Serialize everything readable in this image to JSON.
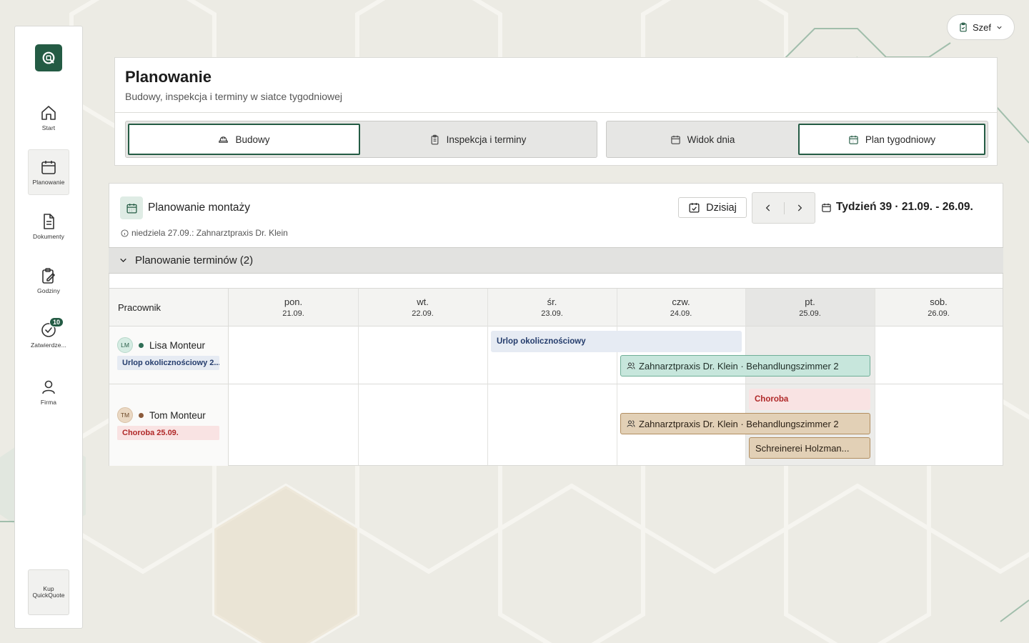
{
  "sidebar": {
    "items": [
      {
        "label": "Start",
        "icon": "home-icon"
      },
      {
        "label": "Planowanie",
        "icon": "calendar-icon"
      },
      {
        "label": "Dokumenty",
        "icon": "document-icon"
      },
      {
        "label": "Godziny",
        "icon": "clipboard-edit-icon"
      },
      {
        "label": "Zatwierdze...",
        "icon": "check-circle-icon",
        "badge": "10"
      },
      {
        "label": "Firma",
        "icon": "user-icon"
      }
    ],
    "buy": {
      "line1": "Kup",
      "line2": "QuickQuote"
    }
  },
  "role": {
    "label": "Szef"
  },
  "header": {
    "title": "Planowanie",
    "subtitle": "Budowy, inspekcja i terminy w siatce tygodniowej",
    "tabs_left": [
      "Budowy",
      "Inspekcja i terminy"
    ],
    "tabs_right": [
      "Widok dnia",
      "Plan tygodniowy"
    ]
  },
  "planner": {
    "title": "Planowanie montaży",
    "note": "niedziela 27.09.: Zahnarztpraxis Dr. Klein",
    "today": "Dzisiaj",
    "week": "Tydzień 39 · 21.09. - 26.09.",
    "group": "Planowanie terminów (2)",
    "employee_header": "Pracownik",
    "days": [
      {
        "name": "pon.",
        "date": "21.09."
      },
      {
        "name": "wt.",
        "date": "22.09."
      },
      {
        "name": "śr.",
        "date": "23.09."
      },
      {
        "name": "czw.",
        "date": "24.09."
      },
      {
        "name": "pt.",
        "date": "25.09."
      },
      {
        "name": "sob.",
        "date": "26.09."
      }
    ],
    "employees": [
      {
        "initials": "LM",
        "name": "Lisa Monteur",
        "tag": "Urlop okolicznościowy 2..."
      },
      {
        "initials": "TM",
        "name": "Tom Monteur",
        "tag": "Choroba 25.09."
      }
    ],
    "events": {
      "lisa_leave": "Urlop okolicznościowy",
      "lisa_job": "Zahnarztpraxis Dr. Klein · Behandlungszimmer 2",
      "tom_sick": "Choroba",
      "tom_job": "Zahnarztpraxis Dr. Klein · Behandlungszimmer 2",
      "tom_job2": "Schreinerei Holzman..."
    }
  },
  "colors": {
    "brand": "#245b44",
    "leave_bg": "#e6ebf3",
    "leave_text": "#243c6c",
    "sick_bg": "#f9e3e3",
    "sick_text": "#b02828",
    "job_green": "#c7e6dc",
    "job_brown": "#e2d0b6"
  }
}
